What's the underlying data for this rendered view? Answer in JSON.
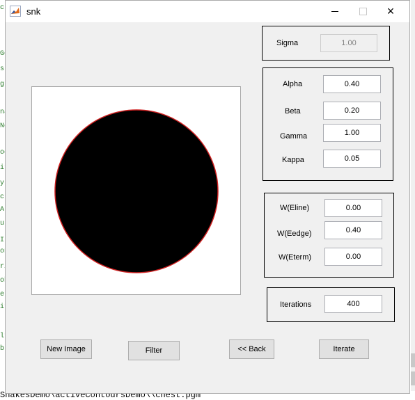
{
  "background": {
    "code_edge_chars": [
      "c",
      "Go",
      "s",
      "gr",
      "na",
      "Ne",
      "od",
      "it",
      "y",
      "c",
      "A",
      "u",
      "I",
      "on",
      "ri",
      "ob",
      "er",
      "it",
      "lt",
      "b"
    ],
    "status_path": "SnakesDemo\\activeContoursDemo\\\\chest.pgm"
  },
  "window": {
    "title": "snk",
    "icon": "matlab-icon",
    "controls": {
      "minimize": "minimize-icon",
      "maximize": "maximize-icon",
      "close": "×"
    }
  },
  "sigma_panel": {
    "label": "Sigma",
    "value": "1.00"
  },
  "params_panel": {
    "alpha_label": "Alpha",
    "alpha_value": "0.40",
    "beta_label": "Beta",
    "beta_value": "0.20",
    "gamma_label": "Gamma",
    "gamma_value": "1.00",
    "kappa_label": "Kappa",
    "kappa_value": "0.05"
  },
  "weights_panel": {
    "eline_label": "W(Eline)",
    "eline_value": "0.00",
    "eedge_label": "W(Eedge)",
    "eedge_value": "0.40",
    "eterm_label": "W(Eterm)",
    "eterm_value": "0.00"
  },
  "iterations_panel": {
    "label": "Iterations",
    "value": "400"
  },
  "buttons": {
    "new_image": "New Image",
    "filter": "Filter",
    "back": "<< Back",
    "iterate": "Iterate"
  },
  "colors": {
    "window_bg": "#f0f0f0",
    "circle_fill": "#000000",
    "snake_contour": "#d02020"
  }
}
